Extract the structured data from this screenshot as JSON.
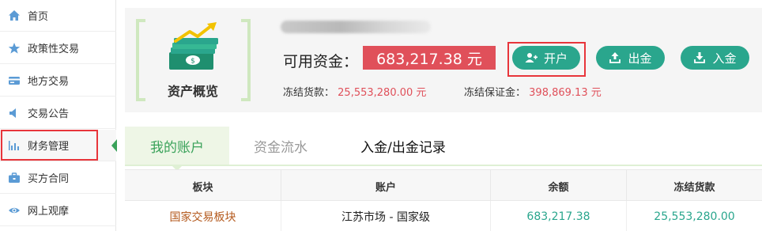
{
  "sidebar": {
    "items": [
      {
        "label": "首页",
        "icon": "home-icon"
      },
      {
        "label": "政策性交易",
        "icon": "star-icon"
      },
      {
        "label": "地方交易",
        "icon": "card-icon"
      },
      {
        "label": "交易公告",
        "icon": "speaker-icon"
      },
      {
        "label": "财务管理",
        "icon": "bar-chart-icon"
      },
      {
        "label": "买方合同",
        "icon": "briefcase-icon"
      },
      {
        "label": "网上观摩",
        "icon": "eye-icon"
      }
    ],
    "active_index": 4
  },
  "summary": {
    "overview_label": "资产概览",
    "available_label": "可用资金：",
    "available_value": "683,217.38 元",
    "frozen_goods_label": "冻结货款：",
    "frozen_goods_value": "25,553,280.00 元",
    "frozen_deposit_label": "冻结保证金：",
    "frozen_deposit_value": "398,869.13 元"
  },
  "buttons": {
    "open_account": "开户",
    "withdraw": "出金",
    "deposit": "入金"
  },
  "tabs": [
    {
      "label": "我的账户",
      "state": "active"
    },
    {
      "label": "资金流水",
      "state": "inactive"
    },
    {
      "label": "入金/出金记录",
      "state": "normal"
    }
  ],
  "table": {
    "headers": [
      "板块",
      "账户",
      "余额",
      "冻结货款"
    ],
    "rows": [
      [
        "国家交易板块",
        "江苏市场 - 国家级",
        "683,217.38",
        "25,553,280.00"
      ]
    ]
  },
  "colors": {
    "accent_green": "#2aa68d",
    "brand_green": "#3aa25a",
    "value_red": "#e0505a",
    "highlight_red": "#e8353b"
  }
}
